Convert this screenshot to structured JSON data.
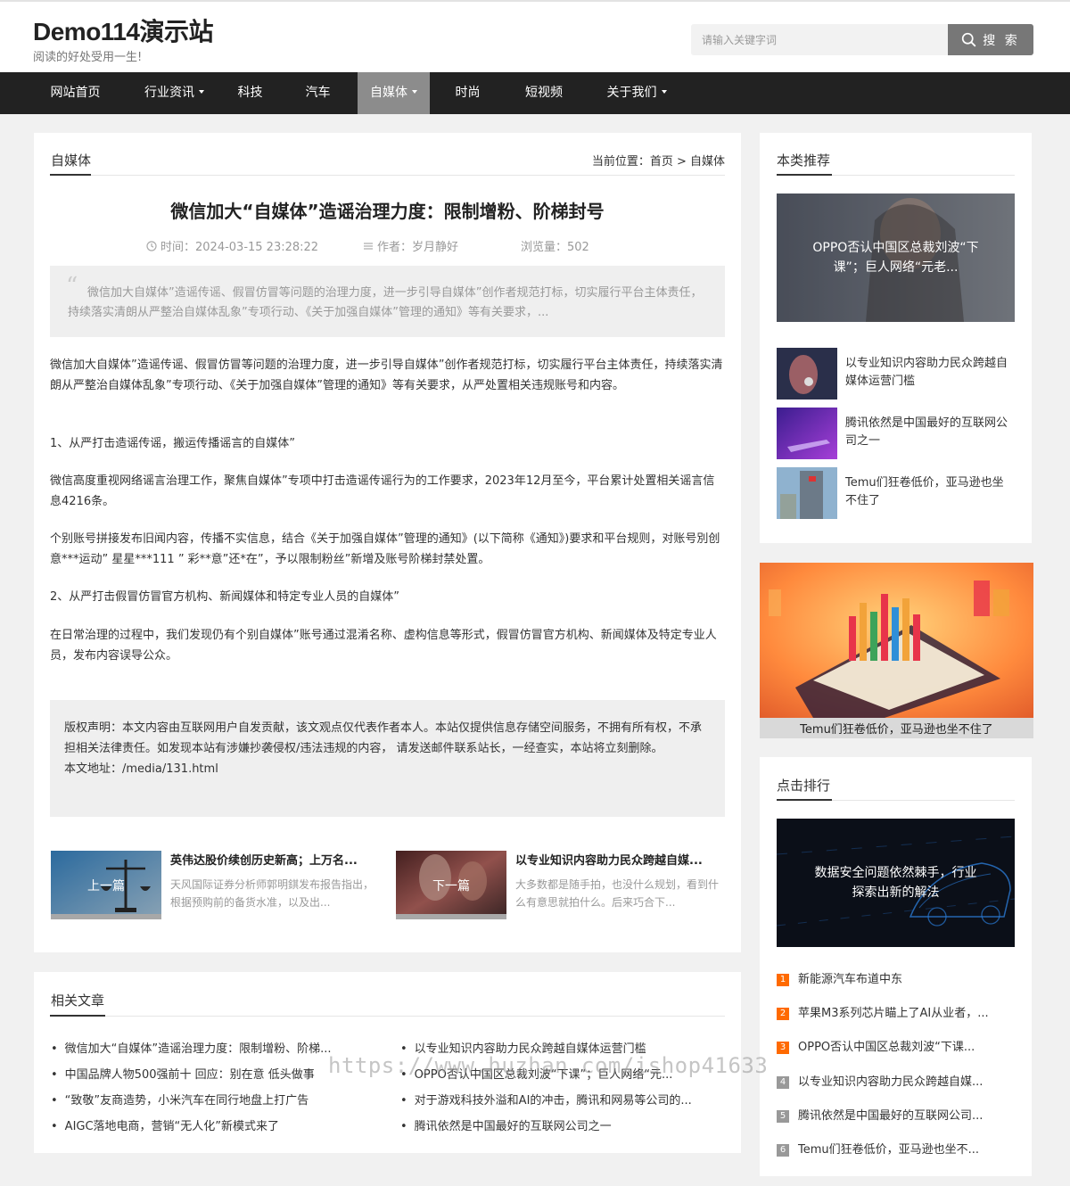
{
  "header": {
    "title": "Demo114演示站",
    "subtitle": "阅读的好处受用一生!",
    "search_placeholder": "请输入关键字词",
    "search_button": "搜 索"
  },
  "nav": [
    {
      "label": "网站首页",
      "dropdown": false,
      "active": false
    },
    {
      "label": "行业资讯",
      "dropdown": true,
      "active": false
    },
    {
      "label": "科技",
      "dropdown": false,
      "active": false
    },
    {
      "label": "汽车",
      "dropdown": false,
      "active": false
    },
    {
      "label": "自媒体",
      "dropdown": true,
      "active": true
    },
    {
      "label": "时尚",
      "dropdown": false,
      "active": false
    },
    {
      "label": "短视频",
      "dropdown": false,
      "active": false
    },
    {
      "label": "关于我们",
      "dropdown": true,
      "active": false
    }
  ],
  "article": {
    "section": "自媒体",
    "breadcrumb": "当前位置：首页 > 自媒体",
    "title": "微信加大“自媒体”造谣治理力度：限制增粉、阶梯封号",
    "time": "时间：2024-03-15 23:28:22",
    "author": "作者：岁月静好",
    "views": "浏览量：502",
    "summary": "微信加大自媒体”造谣传谣、假冒仿冒等问题的治理力度，进一步引导自媒体”创作者规范打标，切实履行平台主体责任，持续落实清朗从严整治自媒体乱象”专项行动、《关于加强自媒体”管理的通知》等有关要求，...",
    "paragraphs": [
      "微信加大自媒体”造谣传谣、假冒仿冒等问题的治理力度，进一步引导自媒体”创作者规范打标，切实履行平台主体责任，持续落实清朗从严整治自媒体乱象”专项行动、《关于加强自媒体”管理的通知》等有关要求，从严处置相关违规账号和内容。",
      "1、从严打击造谣传谣，搬运传播谣言的自媒体”",
      "微信高度重视网络谣言治理工作，聚焦自媒体”专项中打击造谣传谣行为的工作要求，2023年12月至今，平台累计处置相关谣言信息4216条。",
      "个别账号拼接发布旧闻内容，传播不实信息，结合《关于加强自媒体”管理的通知》(以下简称《通知》)要求和平台规则，对账号別创意***运动” 星星***111 ” 彩**意”还*在”，予以限制粉丝”新增及账号阶梯封禁处置。",
      "2、从严打击假冒仿冒官方机构、新闻媒体和特定专业人员的自媒体”",
      "在日常治理的过程中，我们发现仍有个别自媒体”账号通过混淆名称、虚构信息等形式，假冒仿冒官方机构、新闻媒体及特定专业人员，发布内容误导公众。"
    ],
    "copyright": "版权声明：本文内容由互联网用户自发贡献，该文观点仅代表作者本人。本站仅提供信息存储空间服务，不拥有所有权，不承担相关法律责任。如发现本站有涉嫌抄袭侵权/违法违规的内容， 请发送邮件联系站长，一经查实，本站将立刻删除。",
    "url_line": "本文地址：/media/131.html"
  },
  "prev": {
    "label": "上一篇",
    "title": "英伟达股价续创历史新高；上万名...",
    "desc": "天风国际证券分析师郭明錤发布报告指出，根据预购前的备货水准，以及出..."
  },
  "next": {
    "label": "下一篇",
    "title": "以专业知识内容助力民众跨越自媒...",
    "desc": "大多数都是随手拍，也没什么规划，看到什么有意思就拍什么。后来巧合下..."
  },
  "related": {
    "heading": "相关文章",
    "left": [
      "微信加大“自媒体”造谣治理力度：限制增粉、阶梯...",
      "中国品牌人物500强前十 回应：别在意 低头做事",
      "“致敬”友商造势，小米汽车在同行地盘上打广告",
      "AIGC落地电商，营销“无人化”新模式来了"
    ],
    "right": [
      "以专业知识内容助力民众跨越自媒体运营门槛",
      "OPPO否认中国区总裁刘波“下课”；巨人网络“元...",
      "对于游戏科技外溢和AI的冲击，腾讯和网易等公司的...",
      "腾讯依然是中国最好的互联网公司之一"
    ]
  },
  "recommend": {
    "heading": "本类推荐",
    "feature": "OPPO否认中国区总裁刘波“下课”；巨人网络“元老...",
    "items": [
      "以专业知识内容助力民众跨越自媒体运营门槛",
      "腾讯依然是中国最好的互联网公司之一",
      "Temu们狂卷低价，亚马逊也坐不住了"
    ]
  },
  "ad": {
    "caption": "Temu们狂卷低价，亚马逊也坐不住了"
  },
  "ranking": {
    "heading": "点击排行",
    "feature": "数据安全问题依然棘手，行业探索出新的解法",
    "items": [
      {
        "num": "1",
        "title": "新能源汽车布道中东",
        "color": "#ff6a00"
      },
      {
        "num": "2",
        "title": "苹果M3系列芯片瞄上了AI从业者，...",
        "color": "#ff6a00"
      },
      {
        "num": "3",
        "title": "OPPO否认中国区总裁刘波“下课...",
        "color": "#ff6a00"
      },
      {
        "num": "4",
        "title": "以专业知识内容助力民众跨越自媒...",
        "color": "#999999"
      },
      {
        "num": "5",
        "title": "腾讯依然是中国最好的互联网公司...",
        "color": "#999999"
      },
      {
        "num": "6",
        "title": "Temu们狂卷低价，亚马逊也坐不...",
        "color": "#999999"
      }
    ]
  },
  "watermark": "https://www.huzhan.com/ishop41633"
}
